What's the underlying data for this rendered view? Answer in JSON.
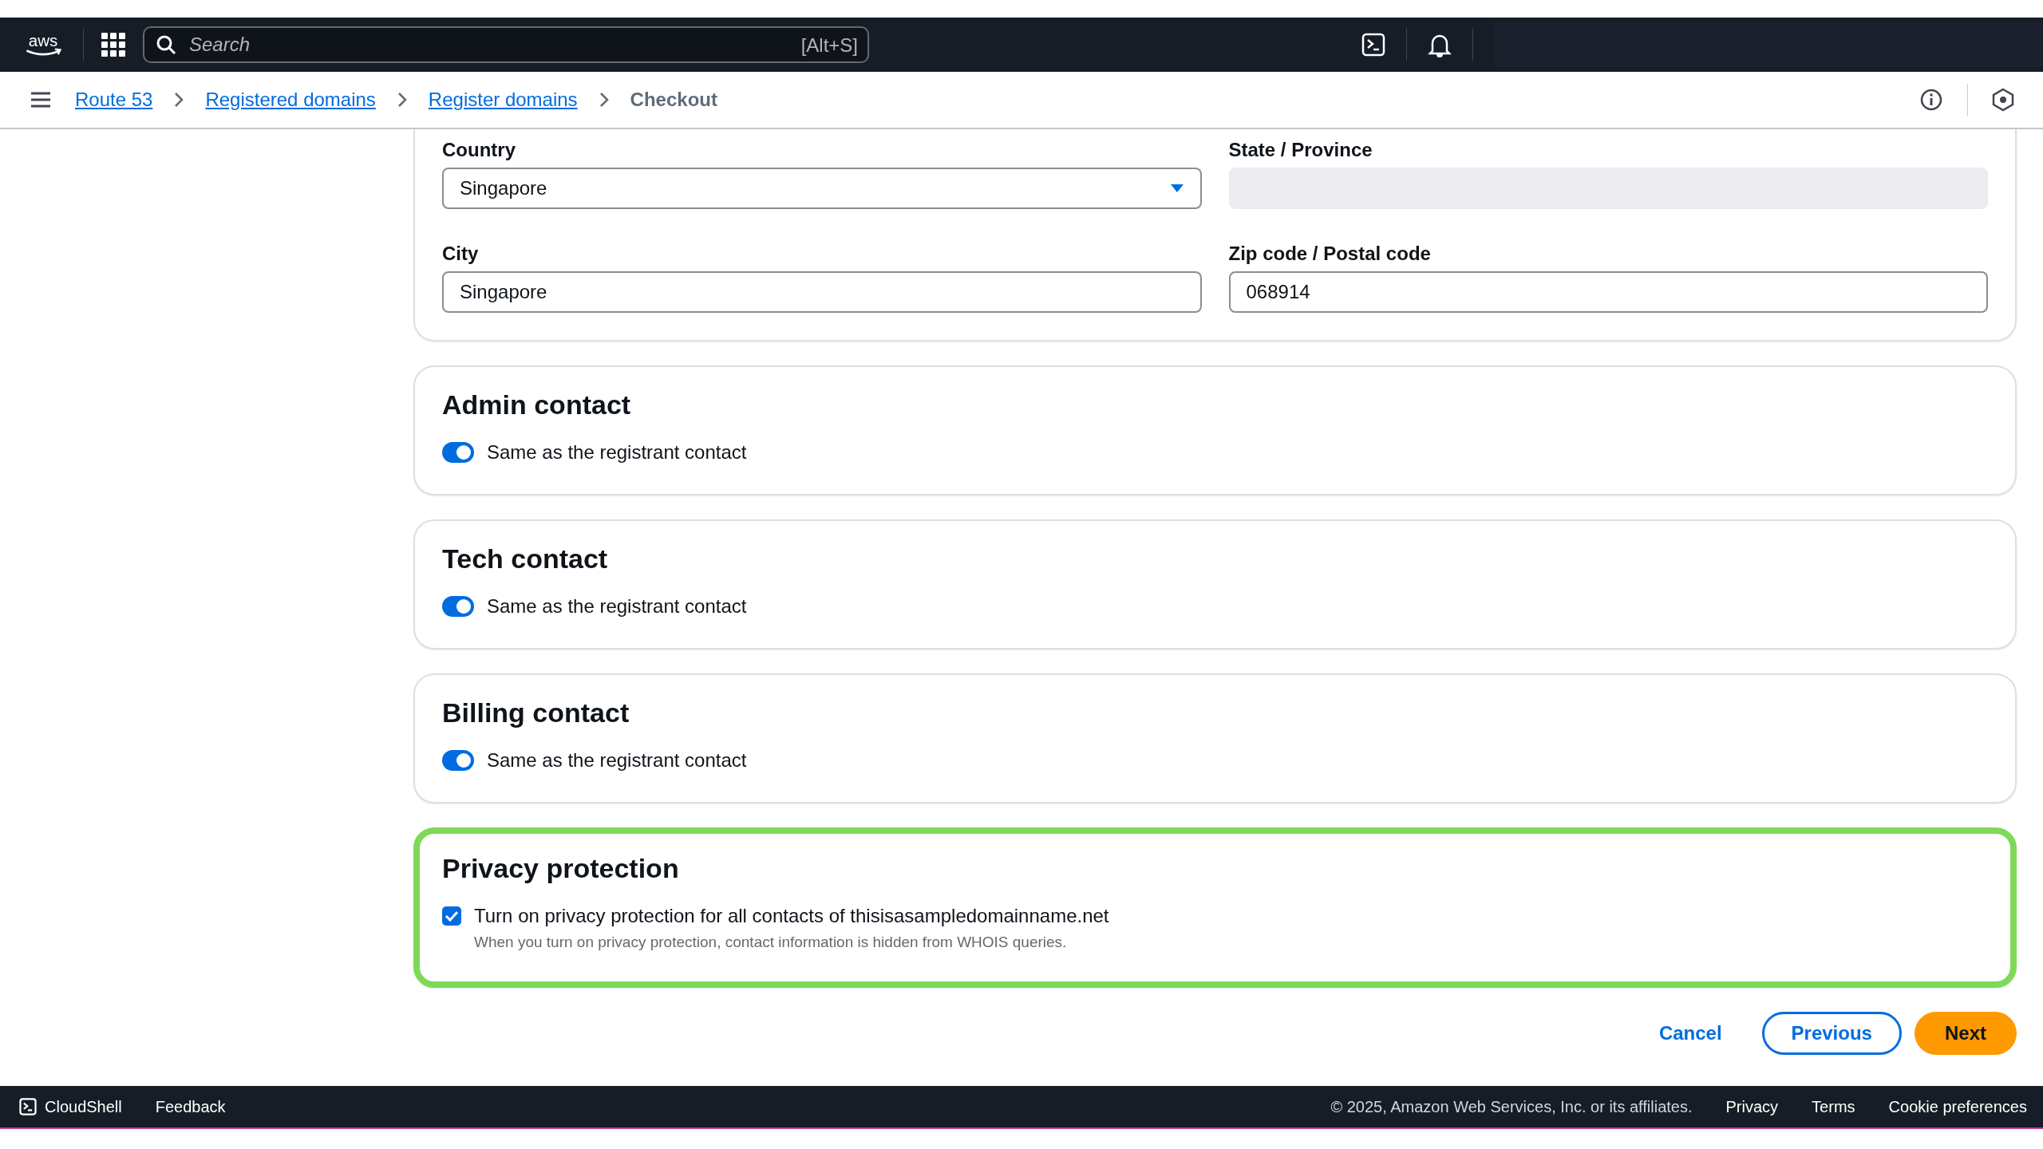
{
  "top_nav": {
    "logo_text": "aws",
    "search": {
      "placeholder": "Search",
      "shortcut": "[Alt+S]"
    }
  },
  "breadcrumbs": [
    {
      "label": "Route 53",
      "kind": "link"
    },
    {
      "label": "Registered domains",
      "kind": "link"
    },
    {
      "label": "Register domains",
      "kind": "link"
    },
    {
      "label": "Checkout",
      "kind": "current"
    }
  ],
  "address_fields": [
    {
      "label": "Country",
      "kind": "select",
      "value": "Singapore",
      "disabled": false
    },
    {
      "label": "State / Province",
      "kind": "text",
      "disabled": true
    },
    {
      "label": "City",
      "kind": "text",
      "value": "Singapore",
      "disabled": false
    },
    {
      "label": "Zip code / Postal code",
      "kind": "text",
      "value": "068914",
      "disabled": false
    }
  ],
  "contacts": [
    {
      "title": "Admin contact",
      "toggle_label": "Same as the registrant contact",
      "on": true
    },
    {
      "title": "Tech contact",
      "toggle_label": "Same as the registrant contact",
      "on": true
    },
    {
      "title": "Billing contact",
      "toggle_label": "Same as the registrant contact",
      "on": true
    }
  ],
  "privacy": {
    "title": "Privacy protection",
    "highlighted": true,
    "checkbox_label": "Turn on privacy protection for all contacts of thisisasampledomainname.net",
    "checked": true,
    "description": "When you turn on privacy protection, contact information is hidden from WHOIS queries."
  },
  "actions": [
    {
      "label": "Cancel",
      "kind": "link"
    },
    {
      "label": "Previous",
      "kind": "secondary"
    },
    {
      "label": "Next",
      "kind": "primary"
    }
  ],
  "footer": {
    "cloudshell": "CloudShell",
    "feedback": "Feedback",
    "copyright": "© 2025, Amazon Web Services, Inc. or its affiliates.",
    "links": [
      "Privacy",
      "Terms",
      "Cookie preferences"
    ]
  }
}
